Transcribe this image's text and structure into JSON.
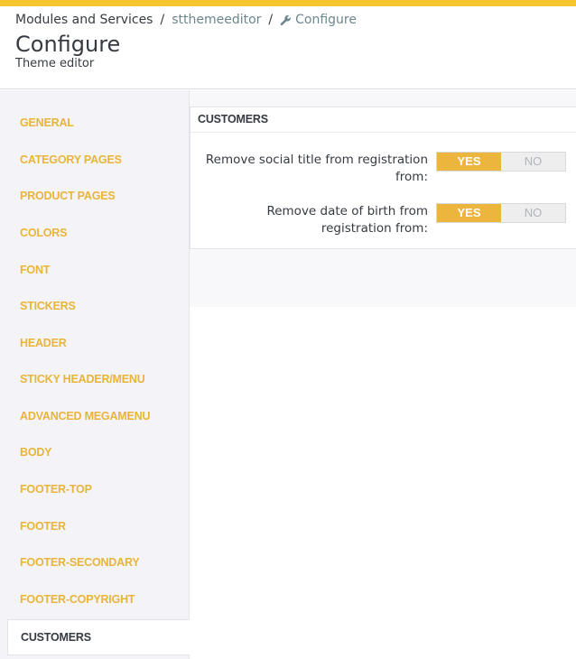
{
  "breadcrumb": {
    "root": "Modules and Services",
    "module": "stthemeeditor",
    "current": "Configure",
    "separator": "/",
    "current_icon": "wrench-icon"
  },
  "header": {
    "title": "Configure",
    "subtitle": "Theme editor"
  },
  "sidebar": {
    "items": [
      {
        "label": "GENERAL"
      },
      {
        "label": "CATEGORY PAGES"
      },
      {
        "label": "PRODUCT PAGES"
      },
      {
        "label": "COLORS"
      },
      {
        "label": "FONT"
      },
      {
        "label": "STICKERS"
      },
      {
        "label": "HEADER"
      },
      {
        "label": "STICKY HEADER/MENU"
      },
      {
        "label": "ADVANCED MEGAMENU"
      },
      {
        "label": "BODY"
      },
      {
        "label": "FOOTER-TOP"
      },
      {
        "label": "FOOTER"
      },
      {
        "label": "FOOTER-SECONDARY"
      },
      {
        "label": "FOOTER-COPYRIGHT"
      }
    ],
    "active": {
      "label": "CUSTOMERS"
    }
  },
  "panel": {
    "title": "CUSTOMERS",
    "rows": [
      {
        "label": "Remove social title from registration from:",
        "yes": "YES",
        "no": "NO",
        "selected": "YES"
      },
      {
        "label": "Remove date of birth from registration from:",
        "yes": "YES",
        "no": "NO",
        "selected": "YES"
      }
    ]
  },
  "colors": {
    "accent": "#f5c530",
    "switch_on": "#ecb53d",
    "sidebar_text": "#e8b53a"
  }
}
